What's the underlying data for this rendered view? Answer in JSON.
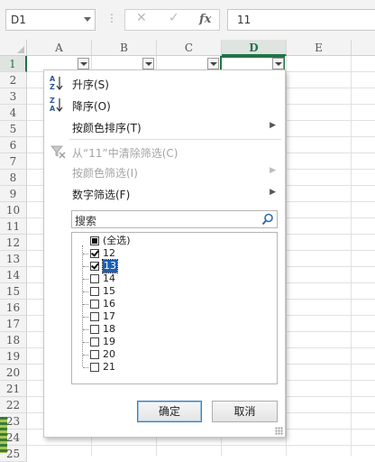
{
  "formula_bar": {
    "name_box": "D1",
    "cancel_icon": "✕",
    "enter_icon": "✓",
    "fx_label": "fx",
    "formula_value": "11"
  },
  "columns": [
    "A",
    "B",
    "C",
    "D",
    "E"
  ],
  "selected_column": "D",
  "rows": [
    "1",
    "2",
    "3",
    "4",
    "5",
    "6",
    "7",
    "8",
    "9",
    "10",
    "11",
    "12",
    "13",
    "14",
    "15",
    "16",
    "17",
    "18",
    "19",
    "20",
    "21",
    "22",
    "23",
    "24",
    "25"
  ],
  "selected_row": "1",
  "menu": {
    "sort_asc": "升序(S)",
    "sort_desc": "降序(O)",
    "sort_by_color": "按颜色排序(T)",
    "clear_filter": "从“11”中清除筛选(C)",
    "filter_by_color": "按颜色筛选(I)",
    "number_filters": "数字筛选(F)"
  },
  "search": {
    "placeholder": "搜索"
  },
  "filter_list": {
    "select_all": "(全选)",
    "items": [
      {
        "label": "12",
        "checked": true
      },
      {
        "label": "13",
        "checked": true,
        "highlighted": true
      },
      {
        "label": "14",
        "checked": false
      },
      {
        "label": "15",
        "checked": false
      },
      {
        "label": "16",
        "checked": false
      },
      {
        "label": "17",
        "checked": false
      },
      {
        "label": "18",
        "checked": false
      },
      {
        "label": "19",
        "checked": false
      },
      {
        "label": "20",
        "checked": false
      },
      {
        "label": "21",
        "checked": false
      }
    ]
  },
  "buttons": {
    "ok": "确定",
    "cancel": "取消"
  },
  "colors": {
    "accent": "#217346",
    "highlight": "#1a5fb4"
  }
}
